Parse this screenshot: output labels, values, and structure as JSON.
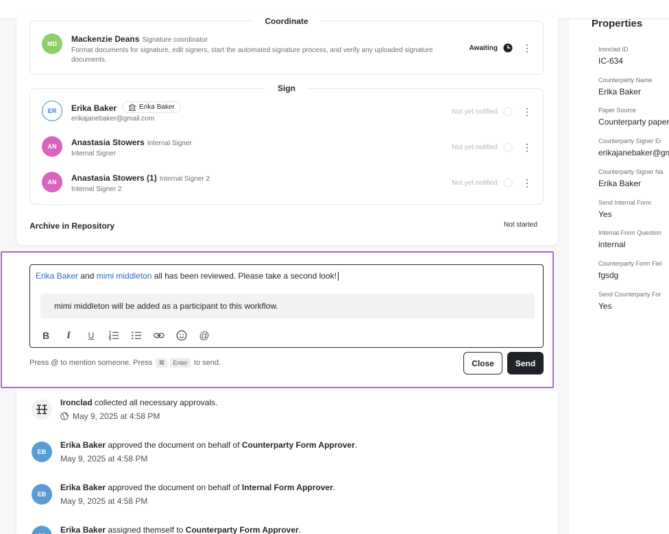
{
  "workflow": {
    "coordinate": {
      "title": "Coordinate",
      "participant": {
        "initials": "MD",
        "name": "Mackenzie Deans",
        "role": "Signature coordinator",
        "description_line1": "Format documents for signature, edit signers, start the automated signature process, and verify any uploaded signature",
        "description_line2": "documents.",
        "status": "Awaiting",
        "avatar_color": "#8fcf6a"
      }
    },
    "sign": {
      "title": "Sign",
      "signers": [
        {
          "initials": "ER",
          "name": "Erika Baker",
          "pill": "Erika Baker",
          "sub": "erikajanebaker@gmail.com",
          "status": "Not yet notified"
        },
        {
          "initials": "AN",
          "name": "Anastasia Stowers",
          "role": "Internal Signer",
          "sub": "Internal Signer",
          "status": "Not yet notified",
          "avatar_color": "#d964bb"
        },
        {
          "initials": "AN",
          "name": "Anastasia Stowers (1)",
          "role": "Internal Signer 2",
          "sub": "Internal Signer 2",
          "status": "Not yet notified",
          "avatar_color": "#d964bb"
        }
      ]
    },
    "archive": {
      "label": "Archive in Repository",
      "status": "Not started"
    }
  },
  "composer": {
    "mention1": "Erika Baker",
    "connector": " and ",
    "mention2": "mimi middleton",
    "message_rest": " all has been reviewed. Please take a second look!",
    "participant_note": "mimi middleton will be added as a participant to this workflow.",
    "hint_prefix": "Press @ to mention someone. Press ",
    "hint_key1": "⌘",
    "hint_key2": "Enter",
    "hint_suffix": " to send.",
    "close_label": "Close",
    "send_label": "Send",
    "toolbar_icons": [
      "bold-icon",
      "italic-icon",
      "underline-icon",
      "numbered-list-icon",
      "bulleted-list-icon",
      "link-icon",
      "emoji-icon",
      "mention-icon"
    ]
  },
  "activity": [
    {
      "initials": "",
      "actor": "Ironclad",
      "text": " collected all necessary approvals.",
      "target": "",
      "time": "May 9, 2025 at 4:58 PM",
      "avatar_type": "logo"
    },
    {
      "initials": "EB",
      "actor": "Erika Baker",
      "text": " approved the document on behalf of ",
      "target": "Counterparty Form Approver",
      "time": "May 9, 2025 at 4:58 PM"
    },
    {
      "initials": "EB",
      "actor": "Erika Baker",
      "text": " approved the document on behalf of ",
      "target": "Internal Form Approver",
      "time": "May 9, 2025 at 4:58 PM"
    },
    {
      "initials": "EB",
      "actor": "Erika Baker",
      "text": " assigned themself to ",
      "target": "Counterparty Form Approver",
      "time": ""
    }
  ],
  "properties": {
    "title": "Properties",
    "items": [
      {
        "label": "Ironclad ID",
        "value": "IC-634"
      },
      {
        "label": "Counterparty Name",
        "value": "Erika Baker"
      },
      {
        "label": "Paper Source",
        "value": "Counterparty paper"
      },
      {
        "label": "Counterparty Signer Er",
        "value": "erikajanebaker@gma"
      },
      {
        "label": "Counterparty Signer Na",
        "value": "Erika Baker"
      },
      {
        "label": "Send Internal Form",
        "value": "Yes"
      },
      {
        "label": "Internal Form Question",
        "value": "internal"
      },
      {
        "label": "Counterparty Form Fiel",
        "value": "fgsdg"
      },
      {
        "label": "Send Counterparty For",
        "value": "Yes"
      }
    ]
  },
  "colors": {
    "accent_purple": "#a866e0",
    "mention_blue": "#2f6bbd",
    "signer_pink": "#d964bb",
    "coordinator_green": "#8fcf6a",
    "activity_blue": "#5b9bd5"
  }
}
